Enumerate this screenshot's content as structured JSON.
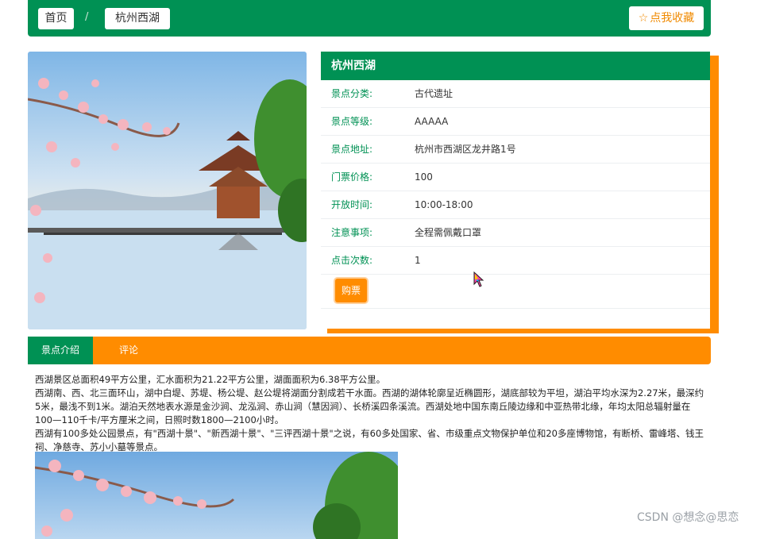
{
  "breadcrumb": {
    "home": "首页",
    "separator": "/",
    "current": "杭州西湖"
  },
  "favorite_button": {
    "icon": "star-outline-icon",
    "label": "点我收藏"
  },
  "spot": {
    "title": "杭州西湖",
    "rows": [
      {
        "key": "景点分类:",
        "value": "古代遗址"
      },
      {
        "key": "景点等级:",
        "value": "AAAAA"
      },
      {
        "key": "景点地址:",
        "value": "杭州市西湖区龙井路1号"
      },
      {
        "key": "门票价格:",
        "value": "100"
      },
      {
        "key": "开放时间:",
        "value": "10:00-18:00"
      },
      {
        "key": "注意事项:",
        "value": "全程需佩戴口罩"
      },
      {
        "key": "点击次数:",
        "value": "1"
      }
    ],
    "buy_label": "购票"
  },
  "tabs": [
    {
      "label": "景点介绍",
      "active": true
    },
    {
      "label": "评论",
      "active": false
    }
  ],
  "intro": {
    "paragraphs": [
      "西湖景区总面积49平方公里，汇水面积为21.22平方公里，湖面面积为6.38平方公里。",
      "西湖南、西、北三面环山，湖中白堤、苏堤、杨公堤、赵公堤将湖面分割成若干水面。西湖的湖体轮廓呈近椭圆形，湖底部较为平坦，湖泊平均水深为2.27米，最深约5米，最浅不到1米。湖泊天然地表水源是金沙涧、龙泓涧、赤山涧（慧因涧）、长桥溪四条溪流。西湖处地中国东南丘陵边缘和中亚热带北缘，年均太阳总辐射量在100—110千卡/平方厘米之间，日照时数1800—2100小时。",
      "西湖有100多处公园景点，有\"西湖十景\"、\"新西湖十景\"、\"三评西湖十景\"之说，有60多处国家、省、市级重点文物保护单位和20多座博物馆，有断桥、雷峰塔、钱王祠、净慈寺、苏小小墓等景点。"
    ]
  },
  "watermark": "CSDN @想念@思恋",
  "colors": {
    "primary_green": "#009154",
    "accent_orange": "#ff8c00"
  }
}
